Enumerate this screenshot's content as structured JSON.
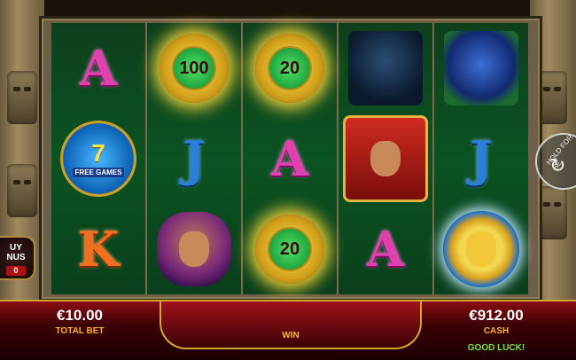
{
  "reels": [
    [
      {
        "type": "letter",
        "value": "A",
        "color": "pink"
      },
      {
        "type": "free_games",
        "value": "7",
        "label": "FREE GAMES"
      },
      {
        "type": "letter",
        "value": "K",
        "color": "orange"
      }
    ],
    [
      {
        "type": "coin",
        "value": "100"
      },
      {
        "type": "letter",
        "value": "J",
        "color": "blue"
      },
      {
        "type": "picture",
        "icon": "queen-icon"
      }
    ],
    [
      {
        "type": "coin",
        "value": "20"
      },
      {
        "type": "letter",
        "value": "A",
        "color": "pink"
      },
      {
        "type": "coin",
        "value": "20"
      }
    ],
    [
      {
        "type": "picture",
        "icon": "monkey-icon"
      },
      {
        "type": "picture",
        "icon": "king-icon"
      },
      {
        "type": "letter",
        "value": "A",
        "color": "pink"
      }
    ],
    [
      {
        "type": "picture",
        "icon": "jaguar-icon"
      },
      {
        "type": "letter",
        "value": "J",
        "color": "blue"
      },
      {
        "type": "picture",
        "icon": "sun-icon"
      }
    ]
  ],
  "buy_bonus": {
    "label_line1": "UY",
    "label_line2": "NUS",
    "count": "0"
  },
  "hold_to_spin": {
    "label": "HOLD FOR SE"
  },
  "bottom_bar": {
    "total_bet": {
      "value": "€10.00",
      "label": "TOTAL BET"
    },
    "win": {
      "label": "WIN"
    },
    "cash": {
      "value": "€912.00",
      "label": "CASH"
    },
    "status": "GOOD LUCK!"
  }
}
